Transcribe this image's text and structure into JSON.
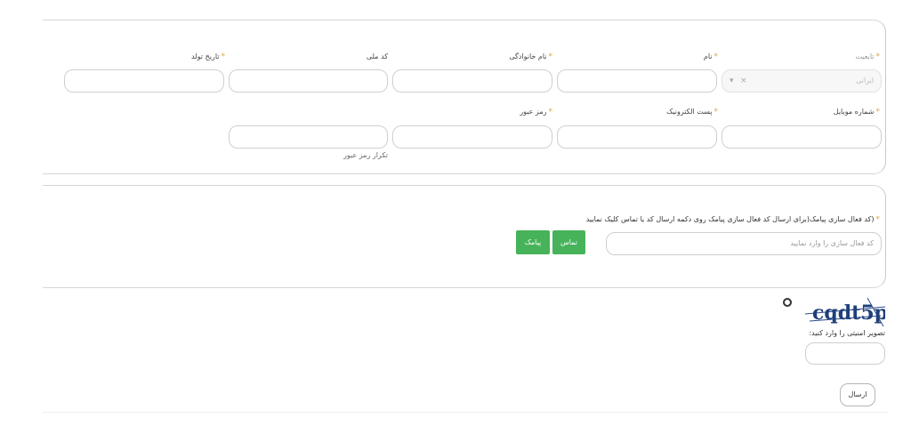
{
  "required_mark": "*",
  "personal": {
    "nationality": {
      "label": "تابعیت",
      "value": "ایرانی",
      "clear_symbol": "×",
      "arrow_symbol": "▾"
    },
    "first_name": {
      "label": "نام"
    },
    "last_name": {
      "label": "نام خانوادگی"
    },
    "national_code": {
      "label": "کد ملی"
    },
    "birth_date": {
      "label": "تاریخ تولد"
    },
    "mobile": {
      "label": "شماره موبایل"
    },
    "email": {
      "label": "پست الکترونیک"
    },
    "password": {
      "label": "رمز عبور"
    },
    "password_repeat": {
      "placeholder": "تکرار رمز عبور"
    }
  },
  "activation": {
    "label": "(کد فعال سازی پیامک(برای ارسال کد فعال سازی پیامک روی دکمه ارسال کد یا تماس کلیک نمایید",
    "placeholder": "کد فعال سازی را وارد نمایید",
    "call_button": "تماس",
    "sms_button": "پیامک"
  },
  "captcha": {
    "text": "cqdt5p",
    "label": "تصویر امنیتی را وارد کنید:",
    "refresh_icon": "refresh-icon"
  },
  "submit": {
    "label": "ارسال"
  }
}
